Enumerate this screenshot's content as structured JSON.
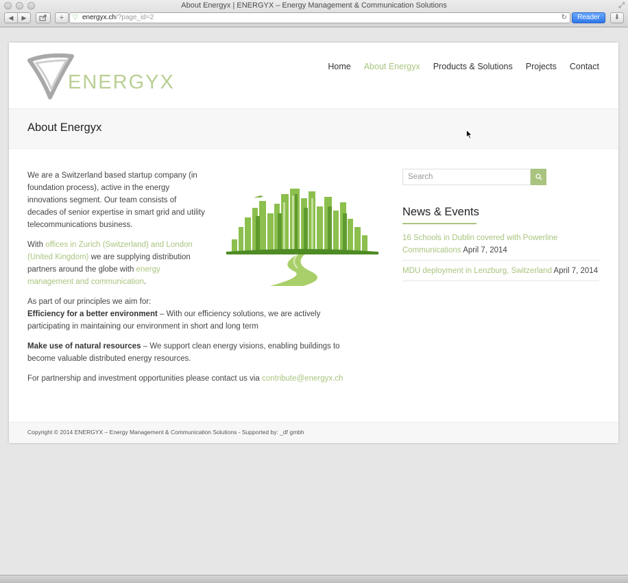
{
  "window": {
    "title": "About Energyx | ENERGYX – Energy Management & Communication Solutions",
    "url_host": "energyx.ch",
    "url_path": "/?page_id=2",
    "reader_label": "Reader"
  },
  "site": {
    "logo_text": "ENERGYX",
    "nav": [
      "Home",
      "About Energyx",
      "Products & Solutions",
      "Projects",
      "Contact"
    ],
    "active_nav": "About Energyx",
    "accent_color": "#a9c47f"
  },
  "page": {
    "title": "About Energyx",
    "intro": "We are a Switzerland based startup company (in foundation process), active in the energy innovations segment. Our team consists of decades of senior expertise in smart grid and utility telecommunications business.",
    "offices_pre": "With ",
    "offices_link": "offices in Zurich (Switzerland) and London (United Kingdom)",
    "offices_mid": " we are supplying distribution partners around the globe with ",
    "offices_link2": "energy management and communication",
    "offices_post": ".",
    "principles_intro": "As part of our principles we aim for:",
    "principle1_title": "Efficiency for a better environment",
    "principle1_text": " – With our efficiency solutions, we are actively participating in maintaining our environment in short and long term",
    "principle2_title": "Make use of natural resources",
    "principle2_text": " – We support clean energy visions, enabling buildings to become valuable distributed energy resources.",
    "contact_text": "For partnership and investment opportunities please contact us via ",
    "contact_email": "contribute@energyx.ch"
  },
  "sidebar": {
    "search_placeholder": "Search",
    "news_title": "News & Events",
    "news": [
      {
        "link": "16 Schools in Dublin covered with Powerline Communications",
        "date": " April 7, 2014"
      },
      {
        "link": "MDU deployment in Lenzburg, Switzerland",
        "date": " April 7, 2014"
      }
    ]
  },
  "footer": {
    "text": "Copyright © 2014 ENERGYX – Energy Management & Communication Solutions - Supported by: _df gmbh"
  }
}
